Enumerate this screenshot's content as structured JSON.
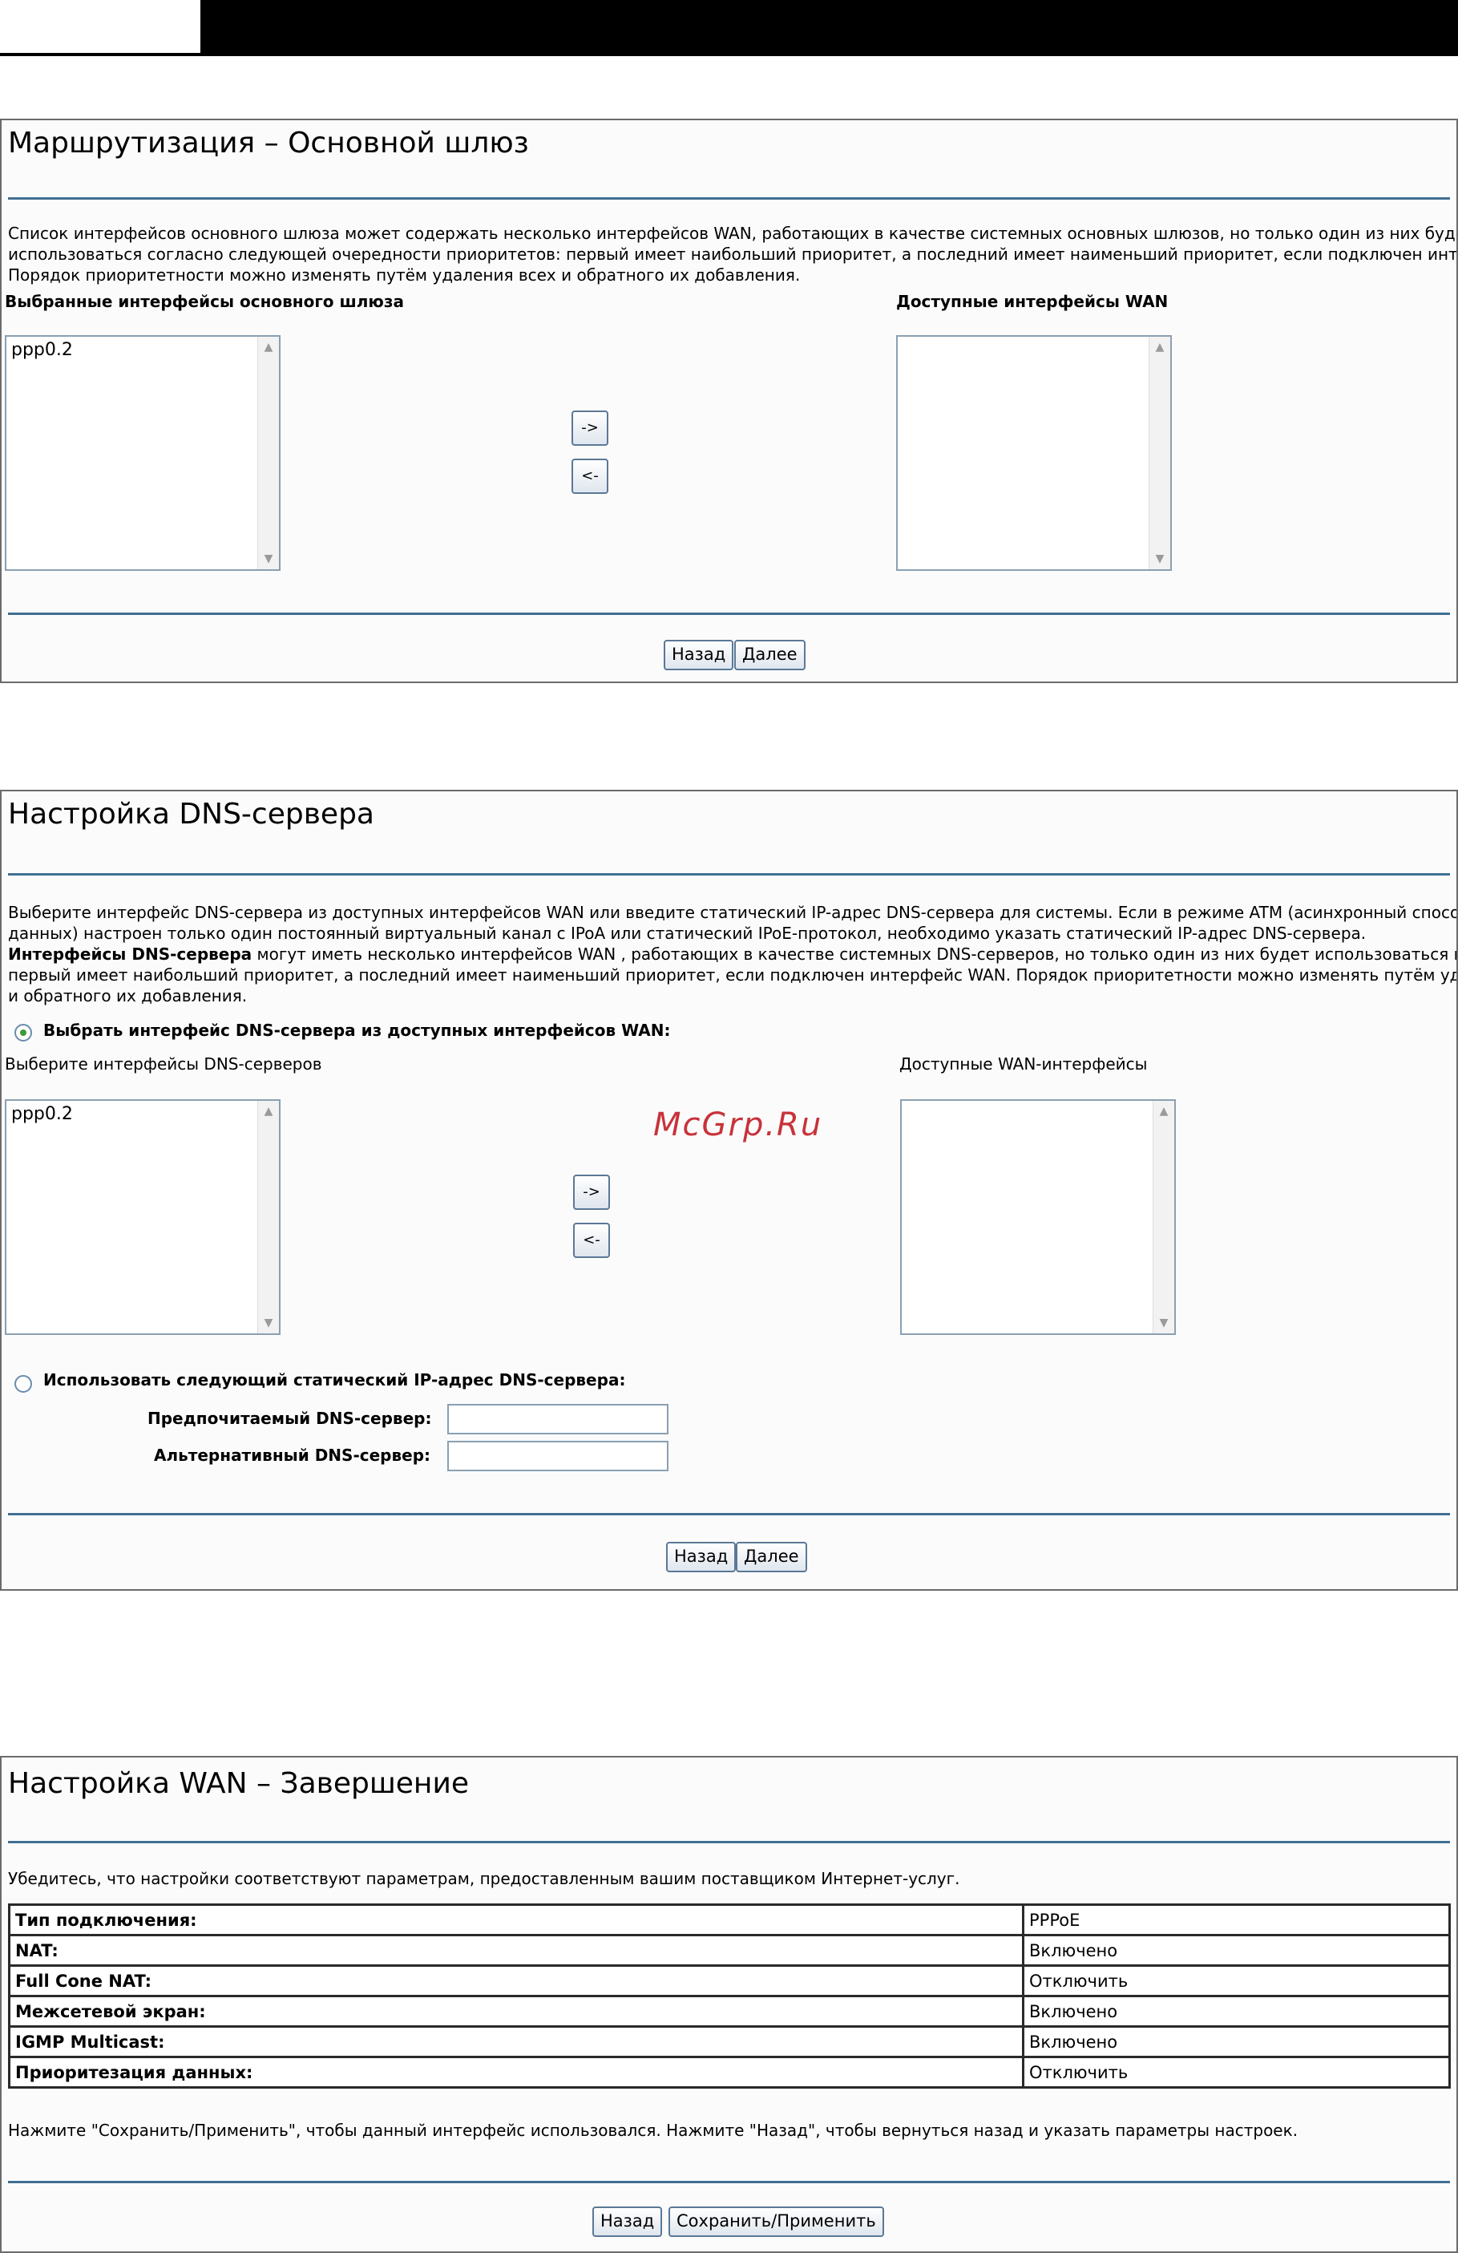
{
  "panel1": {
    "title": "Маршрутизация – Основной шлюз",
    "desc": [
      "Список интерфейсов основного шлюза может содержать несколько интерфейсов WAN, работающих в качестве системных основных шлюзов, но только один из них будет",
      "использоваться согласно следующей очередности приоритетов: первый имеет наибольший приоритет, а последний имеет наименьший приоритет, если подключен интерфейс WAN.",
      "Порядок приоритетности можно изменять путём удаления всех и обратного их добавления."
    ],
    "left_label": "Выбранные интерфейсы основного шлюза",
    "right_label": "Доступные интерфейсы WAN",
    "left_items": [
      "ppp0.2"
    ],
    "right_items": [],
    "arrow_right": "->",
    "arrow_left": "<-",
    "back": "Назад",
    "next": "Далее"
  },
  "panel2": {
    "title": "Настройка DNS-сервера",
    "desc1": "Выберите интерфейс DNS-сервера из доступных интерфейсов WAN или введите статический IP-адрес DNS-сервера для системы. Если в режиме ATM (асинхронный способ передачи",
    "desc2": "данных) настроен только один постоянный виртуальный канал с IPoA или статический IPoE-протокол, необходимо указать статический IP-адрес DNS-сервера.",
    "desc3_bold": "Интерфейсы DNS-сервера",
    "desc3_rest": " могут иметь несколько интерфейсов WAN , работающих в качестве системных DNS-серверов, но только один из них будет использоваться из расчёта, что",
    "desc4": "первый имеет наибольший приоритет, а последний имеет наименьший приоритет, если подключен интерфейс WAN. Порядок приоритетности можно изменять путём удаления всех",
    "desc5": "и обратного их добавления.",
    "radio1_label": "Выбрать интерфейс DNS-сервера из доступных интерфейсов WAN:",
    "left_label": "Выберите интерфейсы DNS-серверов",
    "right_label": "Доступные WAN-интерфейсы",
    "left_items": [
      "ppp0.2"
    ],
    "right_items": [],
    "arrow_right": "->",
    "arrow_left": "<-",
    "radio2_label": "Использовать следующий статический IP-адрес DNS-сервера:",
    "preferred_label": "Предпочитаемый DNS-сервер:",
    "alternate_label": "Альтернативный DNS-сервер:",
    "preferred_value": "",
    "alternate_value": "",
    "back": "Назад",
    "next": "Далее"
  },
  "watermark": "McGrp.Ru",
  "panel3": {
    "title": "Настройка WAN – Завершение",
    "desc": "Убедитесь, что настройки соответствуют параметрам, предоставленным вашим поставщиком Интернет-услуг.",
    "rows": [
      {
        "key": "Тип подключения:",
        "value": "PPPoE"
      },
      {
        "key": "NAT:",
        "value": "Включено"
      },
      {
        "key": "Full Cone NAT:",
        "value": "Отключить"
      },
      {
        "key": "Межсетевой экран:",
        "value": "Включено"
      },
      {
        "key": "IGMP Multicast:",
        "value": "Включено"
      },
      {
        "key": "Приоритезация данных:",
        "value": "Отключить"
      }
    ],
    "note": "Нажмите \"Сохранить/Применить\", чтобы данный интерфейс использовался. Нажмите \"Назад\", чтобы вернуться назад и указать параметры настроек.",
    "back": "Назад",
    "save": "Сохранить/Применить"
  }
}
